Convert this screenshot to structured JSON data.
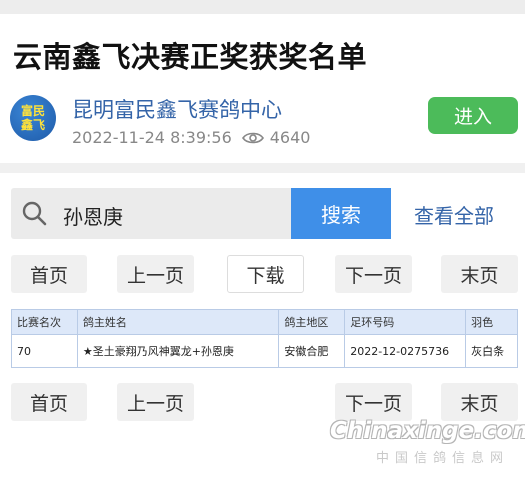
{
  "article": {
    "title": "云南鑫飞决赛正奖获奖名单"
  },
  "publisher": {
    "avatar_text_line1": "富民",
    "avatar_text_line2": "鑫飞",
    "name": "昆明富民鑫飞赛鸽中心",
    "datetime": "2022-11-24 8:39:56",
    "views": "4640",
    "enter_label": "进入"
  },
  "search": {
    "query": "孙恩庚",
    "button_label": "搜索",
    "view_all_label": "查看全部"
  },
  "pager_top": {
    "first": "首页",
    "prev": "上一页",
    "download": "下载",
    "next": "下一页",
    "last": "末页"
  },
  "table": {
    "headers": [
      "比赛名次",
      "鸽主姓名",
      "鸽主地区",
      "足环号码",
      "羽色"
    ],
    "rows": [
      [
        "70",
        "★圣土豪翔乃风神翼龙+孙恩庚",
        "安徽合肥",
        "2022-12-0275736",
        "灰白条"
      ]
    ]
  },
  "pager_bottom": {
    "first": "首页",
    "prev": "上一页",
    "next": "下一页",
    "last": "末页"
  },
  "watermark": {
    "brand": "Chinaxinge.com",
    "sub": "中国信鸽信息网"
  },
  "colors": {
    "accent_blue": "#3f8fe8",
    "link_blue": "#3464a8",
    "enter_green": "#4cbb5a",
    "table_header_bg": "#dde8f9"
  },
  "icons": {
    "search": "search-icon",
    "views": "eye-icon"
  }
}
